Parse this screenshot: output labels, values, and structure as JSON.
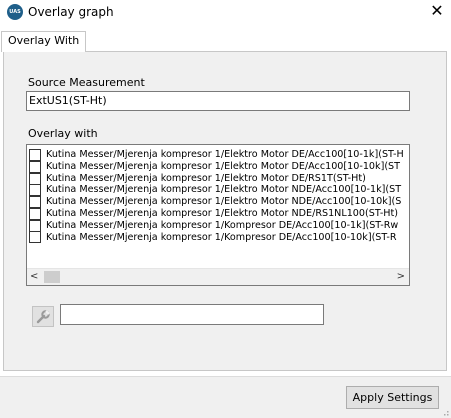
{
  "window": {
    "title": "Overlay graph",
    "icon_text": "UAS",
    "close_label": "✕"
  },
  "tabs": [
    {
      "label": "Overlay With",
      "active": true
    }
  ],
  "source": {
    "label": "Source Measurement",
    "value": "ExtUS1(ST-Ht)"
  },
  "overlay": {
    "label": "Overlay with",
    "items": [
      {
        "label": "Kutina Messer/Mjerenja kompresor 1/Elektro Motor DE/Acc100[10-1k](ST-H",
        "checked": false
      },
      {
        "label": "Kutina Messer/Mjerenja kompresor 1/Elektro Motor DE/Acc100[10-10k](ST",
        "checked": false
      },
      {
        "label": "Kutina Messer/Mjerenja kompresor 1/Elektro Motor DE/RS1T(ST-Ht)",
        "checked": false
      },
      {
        "label": "Kutina Messer/Mjerenja kompresor 1/Elektro Motor NDE/Acc100[10-1k](ST",
        "checked": false
      },
      {
        "label": "Kutina Messer/Mjerenja kompresor 1/Elektro Motor NDE/Acc100[10-10k](S",
        "checked": false
      },
      {
        "label": "Kutina Messer/Mjerenja kompresor 1/Elektro Motor NDE/RS1NL100(ST-Ht)",
        "checked": false
      },
      {
        "label": "Kutina Messer/Mjerenja kompresor 1/Kompresor DE/Acc100[10-1k](ST-Rw",
        "checked": false
      },
      {
        "label": "Kutina Messer/Mjerenja kompresor 1/Kompresor DE/Acc100[10-10k](ST-R",
        "checked": false
      }
    ],
    "scroll_left": "<",
    "scroll_right": ">"
  },
  "filter": {
    "value": "",
    "tool_icon": "wrench-icon"
  },
  "footer": {
    "apply_label": "Apply Settings"
  },
  "colors": {
    "panel_bg": "#f0f0f0",
    "border": "#7a7a7a",
    "icon_bg": "#1f5f8a"
  }
}
